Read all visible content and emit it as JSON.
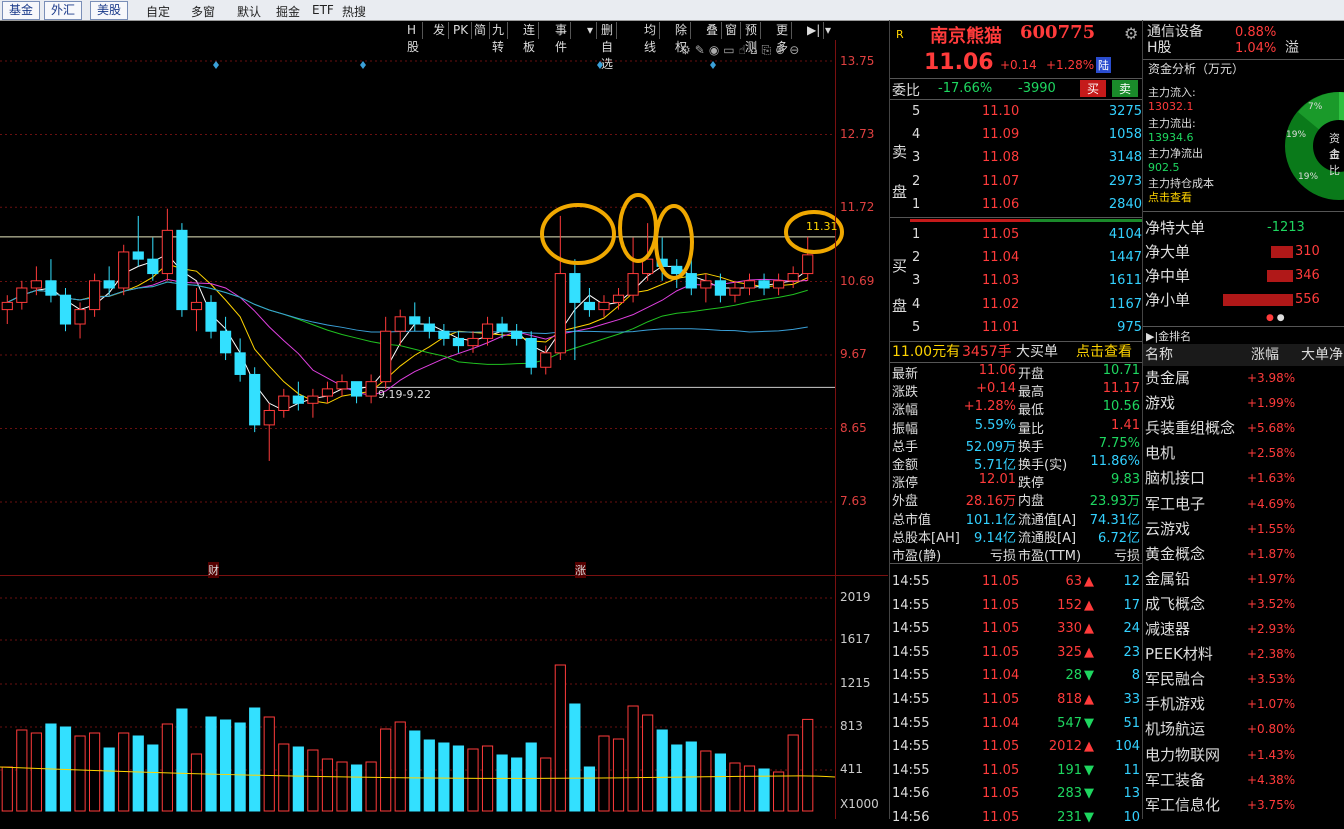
{
  "topbar": {
    "tabs": [
      "基金",
      "外汇",
      "美股"
    ],
    "menu": [
      "自定",
      "多窗",
      "默认",
      "掘金",
      "ETF",
      "热搜"
    ]
  },
  "toolbar": {
    "items": [
      "H股",
      "发",
      "PK",
      "简",
      "九转",
      "连板",
      "事件",
      "▾",
      "删自选",
      "均线",
      "除权",
      "叠",
      "窗",
      "预测",
      "更多",
      "▶|",
      "▾"
    ]
  },
  "chart": {
    "price_labels": [
      "13.75",
      "12.73",
      "11.72",
      "10.69",
      "9.67",
      "8.65",
      "7.63"
    ],
    "vol_labels": [
      "2019",
      "1617",
      "1215",
      "813",
      "411"
    ],
    "vol_unit": "X1000",
    "last_price_tag": "11.31",
    "range_note": "9.19-9.22",
    "event_markers": [
      "财",
      "涨"
    ]
  },
  "chart_data": {
    "type": "candlestick",
    "ylim": [
      7.63,
      13.75
    ],
    "candles": [
      [
        10.3,
        10.5,
        10.1,
        10.4
      ],
      [
        10.4,
        10.7,
        10.3,
        10.6
      ],
      [
        10.6,
        10.9,
        10.5,
        10.7
      ],
      [
        10.7,
        11.0,
        10.4,
        10.5
      ],
      [
        10.5,
        10.6,
        10.0,
        10.1
      ],
      [
        10.1,
        10.4,
        9.9,
        10.3
      ],
      [
        10.3,
        10.8,
        10.2,
        10.7
      ],
      [
        10.7,
        10.9,
        10.5,
        10.6
      ],
      [
        10.6,
        11.2,
        10.5,
        11.1
      ],
      [
        11.1,
        11.6,
        10.9,
        11.0
      ],
      [
        11.0,
        11.3,
        10.7,
        10.8
      ],
      [
        10.8,
        11.7,
        10.7,
        11.4
      ],
      [
        11.4,
        11.5,
        10.2,
        10.3
      ],
      [
        10.3,
        10.6,
        10.0,
        10.4
      ],
      [
        10.4,
        10.5,
        9.9,
        10.0
      ],
      [
        10.0,
        10.2,
        9.6,
        9.7
      ],
      [
        9.7,
        9.9,
        9.3,
        9.4
      ],
      [
        9.4,
        9.5,
        8.6,
        8.7
      ],
      [
        8.7,
        9.0,
        8.2,
        8.9
      ],
      [
        8.9,
        9.2,
        8.8,
        9.1
      ],
      [
        9.1,
        9.3,
        8.9,
        9.0
      ],
      [
        9.0,
        9.2,
        8.8,
        9.1
      ],
      [
        9.1,
        9.3,
        9.0,
        9.2
      ],
      [
        9.2,
        9.4,
        9.1,
        9.3
      ],
      [
        9.3,
        9.3,
        9.0,
        9.1
      ],
      [
        9.1,
        9.4,
        9.0,
        9.3
      ],
      [
        9.3,
        10.2,
        9.2,
        10.0
      ],
      [
        10.0,
        10.3,
        9.8,
        10.2
      ],
      [
        10.2,
        10.4,
        10.0,
        10.1
      ],
      [
        10.1,
        10.2,
        9.9,
        10.0
      ],
      [
        10.0,
        10.1,
        9.8,
        9.9
      ],
      [
        9.9,
        10.0,
        9.7,
        9.8
      ],
      [
        9.8,
        10.0,
        9.7,
        9.9
      ],
      [
        9.9,
        10.2,
        9.8,
        10.1
      ],
      [
        10.1,
        10.2,
        9.9,
        10.0
      ],
      [
        10.0,
        10.1,
        9.8,
        9.9
      ],
      [
        9.9,
        10.0,
        9.4,
        9.5
      ],
      [
        9.5,
        9.8,
        9.4,
        9.7
      ],
      [
        9.7,
        11.6,
        9.6,
        10.8
      ],
      [
        10.8,
        11.0,
        9.6,
        10.4
      ],
      [
        10.4,
        10.6,
        10.2,
        10.3
      ],
      [
        10.3,
        10.5,
        10.2,
        10.4
      ],
      [
        10.4,
        10.6,
        10.3,
        10.5
      ],
      [
        10.5,
        11.3,
        10.4,
        10.8
      ],
      [
        10.8,
        11.5,
        10.7,
        11.0
      ],
      [
        11.0,
        11.3,
        10.7,
        10.9
      ],
      [
        10.9,
        11.0,
        10.6,
        10.8
      ],
      [
        10.8,
        11.0,
        10.5,
        10.6
      ],
      [
        10.6,
        10.8,
        10.4,
        10.7
      ],
      [
        10.7,
        10.8,
        10.4,
        10.5
      ],
      [
        10.5,
        10.7,
        10.4,
        10.6
      ],
      [
        10.6,
        10.8,
        10.5,
        10.7
      ],
      [
        10.7,
        10.8,
        10.5,
        10.6
      ],
      [
        10.6,
        10.8,
        10.5,
        10.7
      ],
      [
        10.7,
        10.9,
        10.6,
        10.8
      ],
      [
        10.8,
        11.31,
        10.7,
        11.06
      ]
    ]
  },
  "stock": {
    "flag": "R",
    "name": "南京熊猫",
    "code": "600775",
    "price": "11.06",
    "change": "+0.14",
    "pct": "+1.28%",
    "hk": "陆"
  },
  "weibi": {
    "label": "委比",
    "ratio": "-17.66%",
    "diff": "-3990",
    "buy": "买",
    "sell": "卖"
  },
  "sell_label": [
    "卖",
    "盘"
  ],
  "buy_label": [
    "买",
    "盘"
  ],
  "asks": [
    [
      "5",
      "11.10",
      "3275"
    ],
    [
      "4",
      "11.09",
      "1058"
    ],
    [
      "3",
      "11.08",
      "3148"
    ],
    [
      "2",
      "11.07",
      "2973"
    ],
    [
      "1",
      "11.06",
      "2840"
    ]
  ],
  "bids": [
    [
      "1",
      "11.05",
      "4104"
    ],
    [
      "2",
      "11.04",
      "1447"
    ],
    [
      "3",
      "11.03",
      "1611"
    ],
    [
      "4",
      "11.02",
      "1167"
    ],
    [
      "5",
      "11.01",
      "975"
    ]
  ],
  "bigorder": {
    "price": "11.00元有",
    "vol": "3457手",
    "label": "大买单",
    "link": "点击查看"
  },
  "stats": [
    [
      "最新",
      "11.06",
      "开盘",
      "10.71"
    ],
    [
      "涨跌",
      "+0.14",
      "最高",
      "11.17"
    ],
    [
      "涨幅",
      "+1.28%",
      "最低",
      "10.56"
    ],
    [
      "振幅",
      "5.59%",
      "量比",
      "1.41"
    ],
    [
      "总手",
      "52.09万",
      "换手",
      "7.75%"
    ],
    [
      "金额",
      "5.71亿",
      "换手(实)",
      "11.86%"
    ],
    [
      "涨停",
      "12.01",
      "跌停",
      "9.83"
    ],
    [
      "外盘",
      "28.16万",
      "内盘",
      "23.93万"
    ],
    [
      "总市值",
      "101.1亿",
      "流通值[A]",
      "74.31亿"
    ],
    [
      "总股本[AH]",
      "9.14亿",
      "流通股[A]",
      "6.72亿"
    ],
    [
      "市盈(静)",
      "亏损",
      "市盈(TTM)",
      "亏损"
    ]
  ],
  "ticks": [
    [
      "14:55",
      "11.05",
      "63",
      "12"
    ],
    [
      "14:55",
      "11.05",
      "152",
      "17"
    ],
    [
      "14:55",
      "11.05",
      "330",
      "24"
    ],
    [
      "14:55",
      "11.05",
      "325",
      "23"
    ],
    [
      "14:55",
      "11.04",
      "28",
      "8"
    ],
    [
      "14:55",
      "11.05",
      "818",
      "33"
    ],
    [
      "14:55",
      "11.04",
      "547",
      "51"
    ],
    [
      "14:55",
      "11.05",
      "2012",
      "104"
    ],
    [
      "14:55",
      "11.05",
      "191",
      "11"
    ],
    [
      "14:56",
      "11.05",
      "283",
      "13"
    ],
    [
      "14:56",
      "11.05",
      "231",
      "10"
    ]
  ],
  "tick_dirs": [
    "up",
    "up",
    "up",
    "up",
    "down",
    "up",
    "down",
    "up",
    "down",
    "down",
    "down"
  ],
  "sector": {
    "name": "通信设备",
    "pct": "0.88%",
    "hname": "H股",
    "hpct": "1.04%",
    "hnote": "溢"
  },
  "fund": {
    "title": "资金分析（万元）",
    "in_label": "主力流入:",
    "in_val": "13032.1",
    "out_label": "主力流出:",
    "out_val": "13934.6",
    "net_label": "主力净流出",
    "net_val": "902.5",
    "cost_label": "主力持仓成本",
    "cost_link": "点击查看",
    "pie": {
      "labels": [
        "7%",
        "19%",
        "19%"
      ],
      "center": [
        "资金",
        "占比"
      ]
    }
  },
  "netflow": [
    [
      "净特大单",
      "-1213"
    ],
    [
      "净大单",
      "310"
    ],
    [
      "净中单",
      "346"
    ],
    [
      "净小单",
      "556"
    ]
  ],
  "rank": {
    "title": "▶|金排名",
    "headers": [
      "名称",
      "涨幅",
      "大单净"
    ],
    "rows": [
      [
        "贵金属",
        "+3.98%"
      ],
      [
        "游戏",
        "+1.99%"
      ],
      [
        "兵装重组概念",
        "+5.68%"
      ],
      [
        "电机",
        "+2.58%"
      ],
      [
        "脑机接口",
        "+1.63%"
      ],
      [
        "军工电子",
        "+4.69%"
      ],
      [
        "云游戏",
        "+1.55%"
      ],
      [
        "黄金概念",
        "+1.87%"
      ],
      [
        "金属铅",
        "+1.97%"
      ],
      [
        "成飞概念",
        "+3.52%"
      ],
      [
        "减速器",
        "+2.93%"
      ],
      [
        "PEEK材料",
        "+2.38%"
      ],
      [
        "军民融合",
        "+3.53%"
      ],
      [
        "手机游戏",
        "+1.07%"
      ],
      [
        "机场航运",
        "+0.80%"
      ],
      [
        "电力物联网",
        "+1.43%"
      ],
      [
        "军工装备",
        "+4.38%"
      ],
      [
        "军工信息化",
        "+3.75%"
      ]
    ]
  }
}
